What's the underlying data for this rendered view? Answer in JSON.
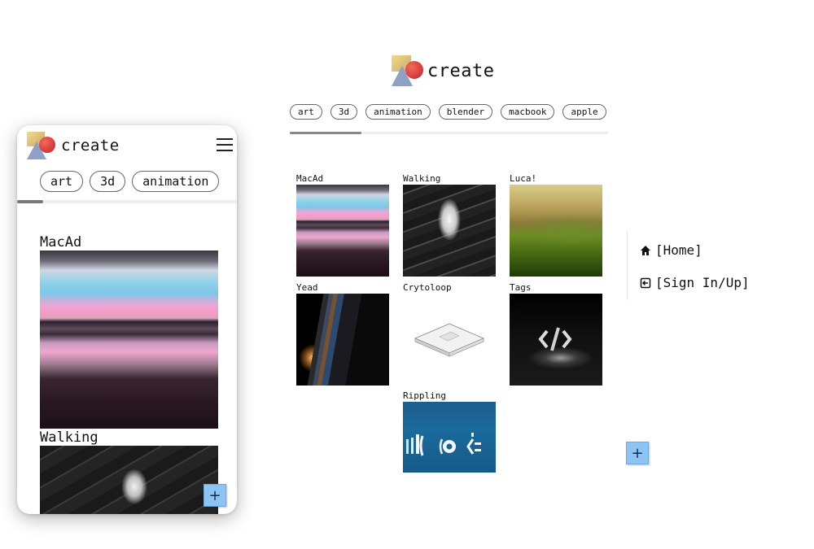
{
  "brand": {
    "name": "create",
    "colors": {
      "accent_red": "#d4252f",
      "accent_gold": "#e8c87a",
      "accent_blue": "#8ea0c4",
      "fab_blue": "#8cc4f4"
    }
  },
  "tags": [
    "art",
    "3d",
    "animation",
    "blender",
    "macbook",
    "apple"
  ],
  "mobile": {
    "tags": [
      "art",
      "3d",
      "animation"
    ],
    "posts": [
      {
        "title": "MacAd"
      },
      {
        "title": "Walking"
      }
    ],
    "fab_label": "+",
    "menu_icon": "hamburger-icon"
  },
  "gallery": [
    {
      "title": "MacAd"
    },
    {
      "title": "Walking"
    },
    {
      "title": "Luca!"
    },
    {
      "title": "Yead"
    },
    {
      "title": "Crytoloop"
    },
    {
      "title": "Tags"
    },
    {
      "title": "Rippling"
    }
  ],
  "side_menu": {
    "items": [
      {
        "label": "[Home]",
        "icon": "home-icon"
      },
      {
        "label": "[Sign In/Up]",
        "icon": "sign-in-icon"
      }
    ]
  },
  "fab_label": "+"
}
